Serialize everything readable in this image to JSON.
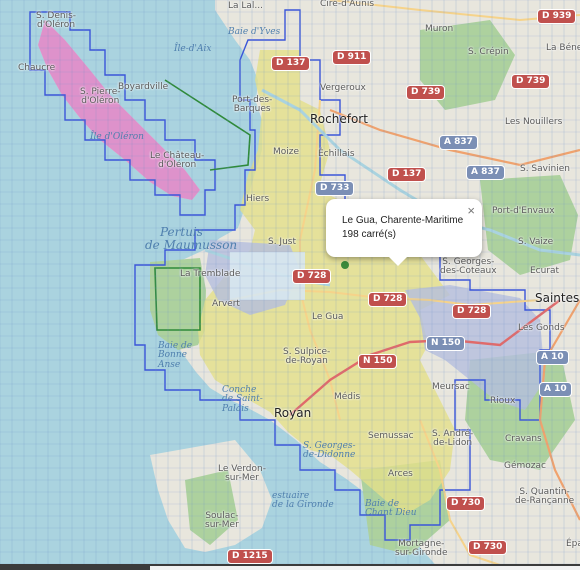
{
  "map": {
    "places": {
      "st_denis": "S. Denis-\nd'Oléron",
      "chaucre": "Chaucre",
      "st_pierre": "S. Pierre-\nd'Oléron",
      "boyardville": "Boyardville",
      "ile_oleron": "Île d'Oléron",
      "le_chateau": "Le Château-\nd'Oléron",
      "ile_aix": "Île-d'Aix",
      "la_laleu": "La Lal...",
      "port_des_barques": "Port-des-\nBarques",
      "vergeroux": "Vergeroux",
      "rochefort": "Rochefort",
      "cire_aunis": "Ciré-d'Aunis",
      "muron": "Muron",
      "st_crepin": "S. Crépin",
      "la_bene": "La Béne",
      "moize": "Moize",
      "echillais": "Échillais",
      "les_nouillers": "Les Nouillers",
      "st_savinien": "S. Savinien",
      "port_envaux": "Port-d'Envaux",
      "hiers": "Hiers",
      "st_just": "S. Just",
      "la_tremblade": "La Tremblade",
      "arvert": "Arvert",
      "st_vaize": "S. Vaize",
      "st_georges": "S. Georges-\ndes-Coteaux",
      "ecurat": "Ecurat",
      "saintes": "Saintes",
      "le_gua": "Le Gua",
      "les_gonds": "Les Gonds",
      "st_sulpice": "S. Sulpice-\nde-Royan",
      "medis": "Médis",
      "meursac": "Meursac",
      "rioux": "Rioux",
      "royan": "Royan",
      "semussac": "Semussac",
      "st_andre": "S. André-\nde-Lidon",
      "cravans": "Cravans",
      "st_georges_didonne": "S. Georges-\nde-Didonne",
      "gemozac": "Gémozac",
      "arces": "Arces",
      "le_verdon": "Le Verdon-\nsur-Mer",
      "soulac": "Soulac-\nsur-Mer",
      "st_quantin": "S. Quantin-\nde-Rançanne",
      "mortagne": "Mortagne-\nsur-Gironde",
      "epargnes": "Épargnes",
      "pertuis": "Pertuis",
      "maumusson": "de Maumusson",
      "baie_yves": "Baie d'Yves",
      "anse_bonne": "Baie de\nBonne\nAnse",
      "conche": "Conche\nde Saint-\nPalais",
      "estuaire": "estuaire\nde la Gironde",
      "baie_chant": "Baie de\nChant Dieu"
    },
    "roads": {
      "d939": "D 939",
      "d911": "D 911",
      "d739a": "D 739",
      "d739b": "D 739",
      "a837a": "A 837",
      "d137": "D 137",
      "a837b": "A 837",
      "d733": "D 733",
      "d728a": "D 728",
      "d728b": "D 728",
      "d728c": "D 728",
      "n150a": "N 150",
      "n150b": "N 150",
      "a10a": "A 10",
      "a10b": "A 10",
      "d730a": "D 730",
      "d730b": "D 730",
      "d1215": "D 1215",
      "d137b": "D 137"
    },
    "colors": {
      "land": "#e8e6dd",
      "sea": "#aad3df",
      "forest": "#add19e",
      "coverage_yellow": "#e4e089",
      "coverage_blue": "#b4bedf",
      "coverage_pink": "#dc82c8",
      "grid_stroke": "#3a55d9"
    }
  },
  "popup": {
    "title": "Le Gua, Charente-Maritime",
    "count": "198 carré(s)",
    "close": "×"
  }
}
